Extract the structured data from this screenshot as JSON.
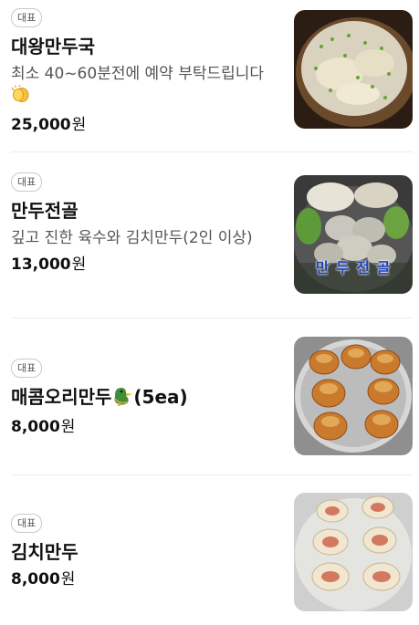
{
  "menu": {
    "items": [
      {
        "badge": "대표",
        "name": "대왕만두국",
        "description": "최소 40~60분전에 예약 부탁드립니다",
        "price": "25,000",
        "currency": "원",
        "name_emoji": "",
        "description_emoji": "clapping-hands-icon"
      },
      {
        "badge": "대표",
        "name": "만두전골",
        "description": "깊고 진한 육수와 김치만두(2인 이상)",
        "price": "13,000",
        "currency": "원",
        "thumb_caption": "만 두 전 골"
      },
      {
        "badge": "대표",
        "name": "매콤오리만두",
        "name_suffix": "(5ea)",
        "name_emoji": "duck-icon",
        "price": "8,000",
        "currency": "원"
      },
      {
        "badge": "대표",
        "name": "김치만두",
        "price": "8,000",
        "currency": "원"
      }
    ]
  }
}
